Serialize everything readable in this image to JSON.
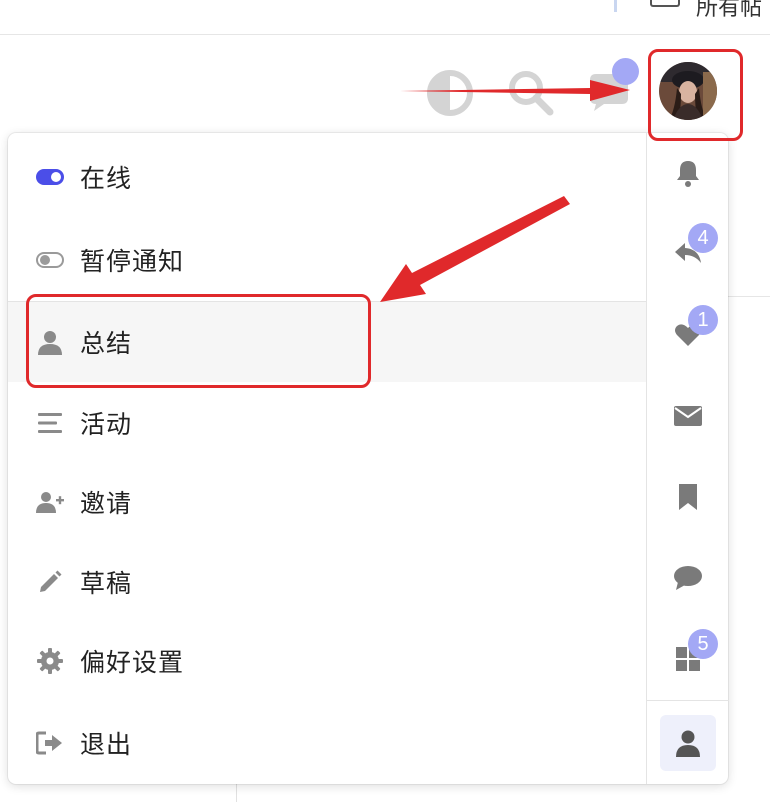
{
  "top": {
    "tab_label": "所有帖"
  },
  "menu": {
    "items": [
      {
        "id": "online",
        "label": "在线",
        "icon": "toggle-on-icon"
      },
      {
        "id": "pause",
        "label": "暂停通知",
        "icon": "toggle-off-icon"
      },
      {
        "id": "summary",
        "label": "总结",
        "icon": "user-icon",
        "active": true
      },
      {
        "id": "activity",
        "label": "活动",
        "icon": "list-icon"
      },
      {
        "id": "invite",
        "label": "邀请",
        "icon": "user-plus-icon"
      },
      {
        "id": "drafts",
        "label": "草稿",
        "icon": "pencil-icon"
      },
      {
        "id": "prefs",
        "label": "偏好设置",
        "icon": "gear-icon"
      },
      {
        "id": "logout",
        "label": "退出",
        "icon": "sign-out-icon"
      }
    ]
  },
  "rail": {
    "items": [
      {
        "icon": "bell-icon",
        "badge": ""
      },
      {
        "icon": "reply-icon",
        "badge": "4"
      },
      {
        "icon": "heart-icon",
        "badge": "1"
      },
      {
        "icon": "envelope-icon",
        "badge": ""
      },
      {
        "icon": "bookmark-icon",
        "badge": ""
      },
      {
        "icon": "comment-icon",
        "badge": ""
      },
      {
        "icon": "grid-icon",
        "badge": "5"
      },
      {
        "icon": "user-icon",
        "badge": "",
        "active": true
      }
    ]
  },
  "colors": {
    "accent": "#4b4ee8",
    "badge": "#a3a8f5",
    "annotation": "#e0292b",
    "icon_gray": "#7a7a7a"
  }
}
